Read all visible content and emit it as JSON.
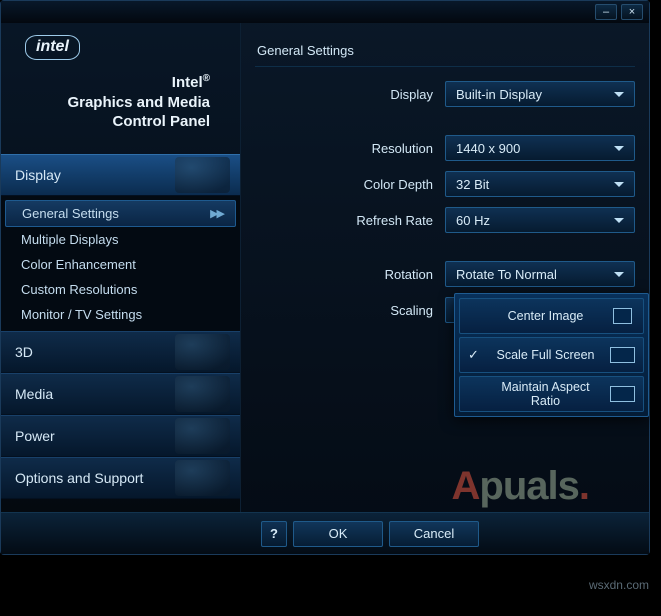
{
  "titlebar": {
    "minimize": "–",
    "close": "×"
  },
  "logo_text": "intel",
  "panel_title_l1": "Intel",
  "panel_title_l2": "Graphics and Media",
  "panel_title_l3": "Control Panel",
  "registered": "®",
  "sidebar": {
    "categories": [
      {
        "label": "Display",
        "active": true
      },
      {
        "label": "3D",
        "active": false
      },
      {
        "label": "Media",
        "active": false
      },
      {
        "label": "Power",
        "active": false
      },
      {
        "label": "Options and Support",
        "active": false
      }
    ],
    "subitems": [
      {
        "label": "General Settings",
        "active": true
      },
      {
        "label": "Multiple Displays",
        "active": false
      },
      {
        "label": "Color Enhancement",
        "active": false
      },
      {
        "label": "Custom Resolutions",
        "active": false
      },
      {
        "label": "Monitor / TV Settings",
        "active": false
      }
    ]
  },
  "content_header": "General Settings",
  "settings": {
    "rows": [
      {
        "label": "Display",
        "value": "Built-in Display"
      },
      {
        "label": "Resolution",
        "value": "1440 x 900"
      },
      {
        "label": "Color Depth",
        "value": "32 Bit"
      },
      {
        "label": "Refresh Rate",
        "value": "60 Hz"
      },
      {
        "label": "Rotation",
        "value": "Rotate To Normal"
      },
      {
        "label": "Scaling",
        "value": "Scale Full Screen"
      }
    ]
  },
  "scaling_popup": {
    "items": [
      {
        "label": "Center Image",
        "checked": false
      },
      {
        "label": "Scale Full Screen",
        "checked": true
      },
      {
        "label": "Maintain Aspect Ratio",
        "checked": false
      }
    ]
  },
  "bottom": {
    "help": "?",
    "ok": "OK",
    "cancel": "Cancel"
  },
  "watermark_prefix": "A",
  "watermark_rest": "puals",
  "watermark_dot": ".",
  "source_text": "wsxdn.com"
}
